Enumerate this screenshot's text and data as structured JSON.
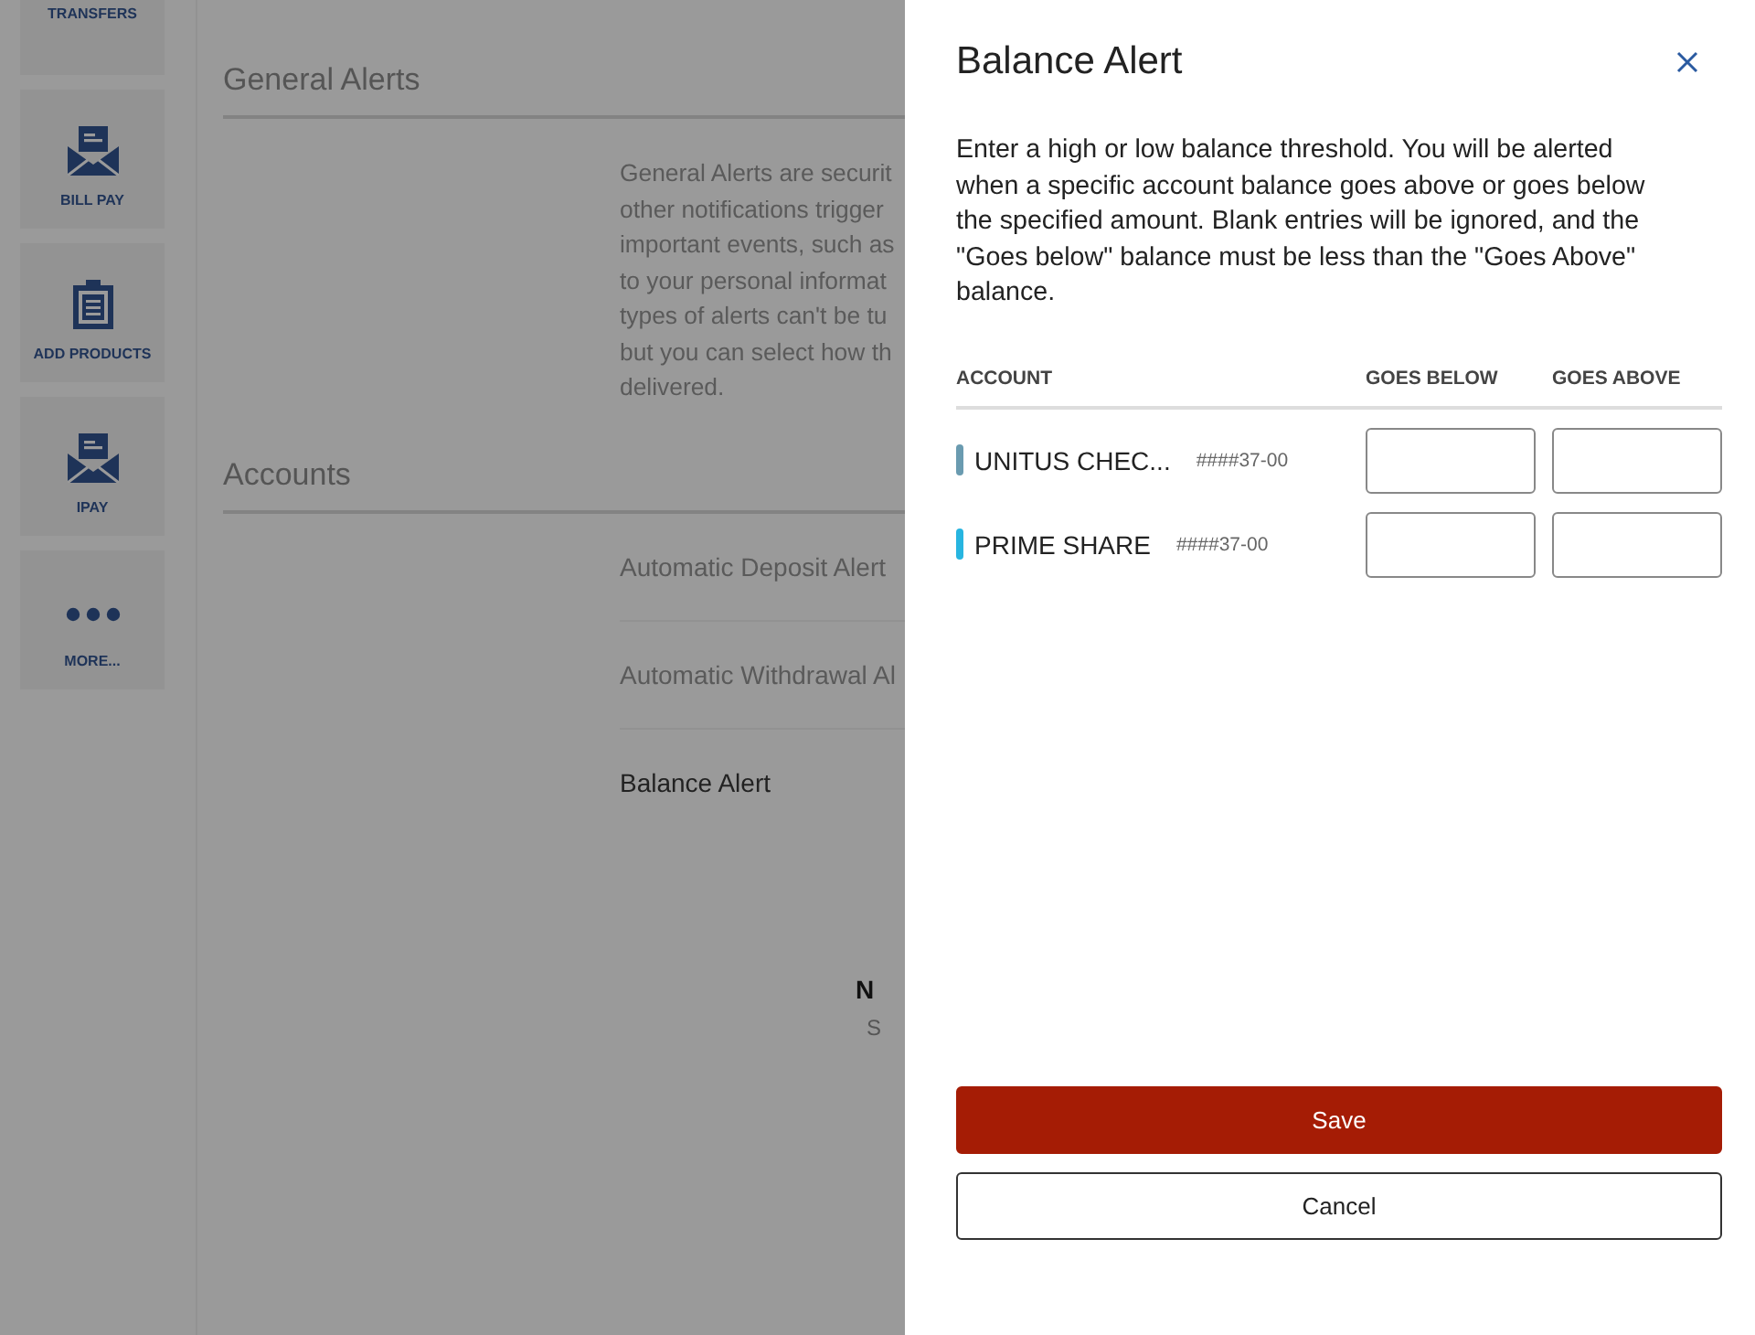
{
  "sidebar": {
    "items": [
      {
        "label": "TRANSFERS",
        "kind": "cut"
      },
      {
        "label": "BILL PAY",
        "kind": "envelope"
      },
      {
        "label": "ADD PRODUCTS",
        "kind": "clipboard"
      },
      {
        "label": "IPAY",
        "kind": "envelope"
      },
      {
        "label": "MORE...",
        "kind": "dots"
      }
    ]
  },
  "main": {
    "sections": [
      {
        "heading": "General Alerts",
        "lines": [
          "General Alerts are securit",
          "other notifications trigger",
          "important events, such as",
          "to your personal informat",
          "types of alerts can't be tu",
          "but you can select how th",
          "delivered."
        ]
      },
      {
        "heading": "Accounts",
        "items": [
          {
            "label": "Automatic Deposit Alert",
            "selected": false
          },
          {
            "label": "Automatic Withdrawal Al",
            "selected": false
          },
          {
            "label": "Balance Alert",
            "selected": true
          }
        ]
      }
    ],
    "empty_title": "N",
    "empty_text": "S"
  },
  "panel": {
    "title": "Balance Alert",
    "description": "Enter a high or low balance threshold. You will be alerted when a specific account balance goes above or goes below the specified amount. Blank entries will be ignored, and the \"Goes below\" balance must be less than the \"Goes Above\" balance.",
    "columns": [
      "ACCOUNT",
      "GOES BELOW",
      "GOES ABOVE"
    ],
    "accounts": [
      {
        "name": "UNITUS CHEC...",
        "number": "####37-00",
        "color": "#6a9bb0"
      },
      {
        "name": "PRIME SHARE",
        "number": "####37-00",
        "color": "#27b5e0"
      }
    ],
    "buttons": [
      {
        "label": "Save",
        "kind": "primary"
      },
      {
        "label": "Cancel",
        "kind": "secondary"
      }
    ]
  }
}
